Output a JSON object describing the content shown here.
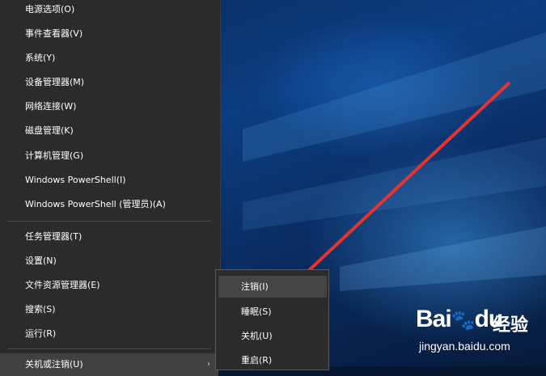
{
  "menu": {
    "items": [
      {
        "label": "电源选项(O)"
      },
      {
        "label": "事件查看器(V)"
      },
      {
        "label": "系统(Y)"
      },
      {
        "label": "设备管理器(M)"
      },
      {
        "label": "网络连接(W)"
      },
      {
        "label": "磁盘管理(K)"
      },
      {
        "label": "计算机管理(G)"
      },
      {
        "label": "Windows PowerShell(I)"
      },
      {
        "label": "Windows PowerShell (管理员)(A)"
      },
      {
        "label": "任务管理器(T)"
      },
      {
        "label": "设置(N)"
      },
      {
        "label": "文件资源管理器(E)"
      },
      {
        "label": "搜索(S)"
      },
      {
        "label": "运行(R)"
      },
      {
        "label": "关机或注销(U)"
      }
    ],
    "submenu_arrow_icon": "chevron-right-icon"
  },
  "submenu": {
    "items": [
      {
        "label": "注销(I)"
      },
      {
        "label": "睡眠(S)"
      },
      {
        "label": "关机(U)"
      },
      {
        "label": "重启(R)"
      }
    ]
  },
  "annotation": {
    "arrow_color": "#e8322e"
  },
  "watermark": {
    "logo": "Bai",
    "logo_suffix": "du",
    "jingyan": "经验",
    "url": "jingyan.baidu.com"
  },
  "colors": {
    "menu_bg": "#2b2b2b",
    "menu_text": "#ffffff",
    "highlight_bg": "#414141"
  }
}
